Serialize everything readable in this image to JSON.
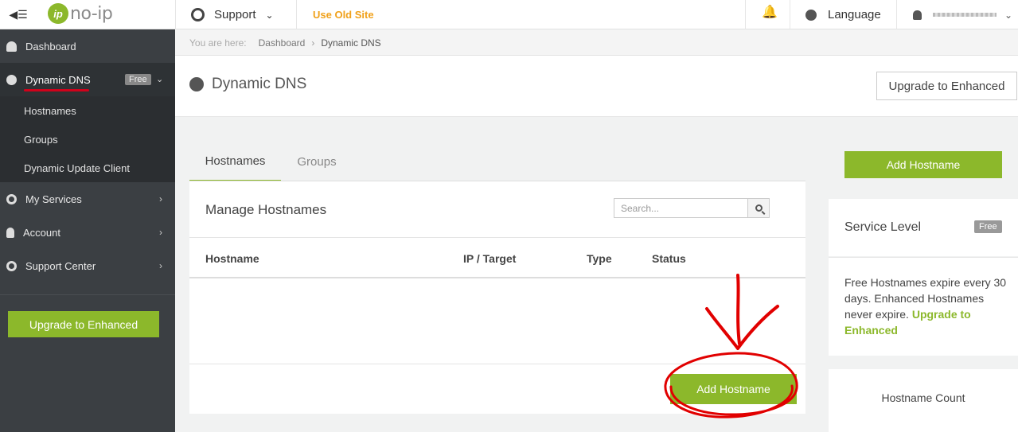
{
  "topbar": {
    "logo_text": "no-ip",
    "support_label": "Support",
    "old_site_label": "Use Old Site",
    "language_label": "Language"
  },
  "sidebar": {
    "items": [
      {
        "label": "Dashboard"
      },
      {
        "label": "Dynamic DNS",
        "badge": "Free"
      },
      {
        "label": "My Services"
      },
      {
        "label": "Account"
      },
      {
        "label": "Support Center"
      }
    ],
    "subitems": [
      {
        "label": "Hostnames"
      },
      {
        "label": "Groups"
      },
      {
        "label": "Dynamic Update Client"
      }
    ],
    "upgrade_label": "Upgrade to Enhanced"
  },
  "breadcrumb": {
    "prefix": "You are here:",
    "items": [
      "Dashboard",
      "Dynamic DNS"
    ]
  },
  "page": {
    "title": "Dynamic DNS",
    "upgrade_label": "Upgrade to Enhanced"
  },
  "tabs": [
    {
      "label": "Hostnames",
      "active": true
    },
    {
      "label": "Groups",
      "active": false
    }
  ],
  "panel": {
    "title": "Manage Hostnames",
    "search_placeholder": "Search...",
    "columns": [
      "Hostname",
      "IP / Target",
      "Type",
      "Status"
    ],
    "add_label": "Add Hostname"
  },
  "right": {
    "add_label": "Add Hostname",
    "service_level_label": "Service Level",
    "service_level_badge": "Free",
    "note_text": "Free Hostnames expire every 30 days. Enhanced Hostnames never expire.",
    "note_link": "Upgrade to Enhanced",
    "hostname_count_label": "Hostname Count"
  },
  "colors": {
    "accent_green": "#8cb82b",
    "sidebar_bg": "#3b3f43",
    "old_site_orange": "#f0a11b",
    "annotation_red": "#e10000"
  }
}
